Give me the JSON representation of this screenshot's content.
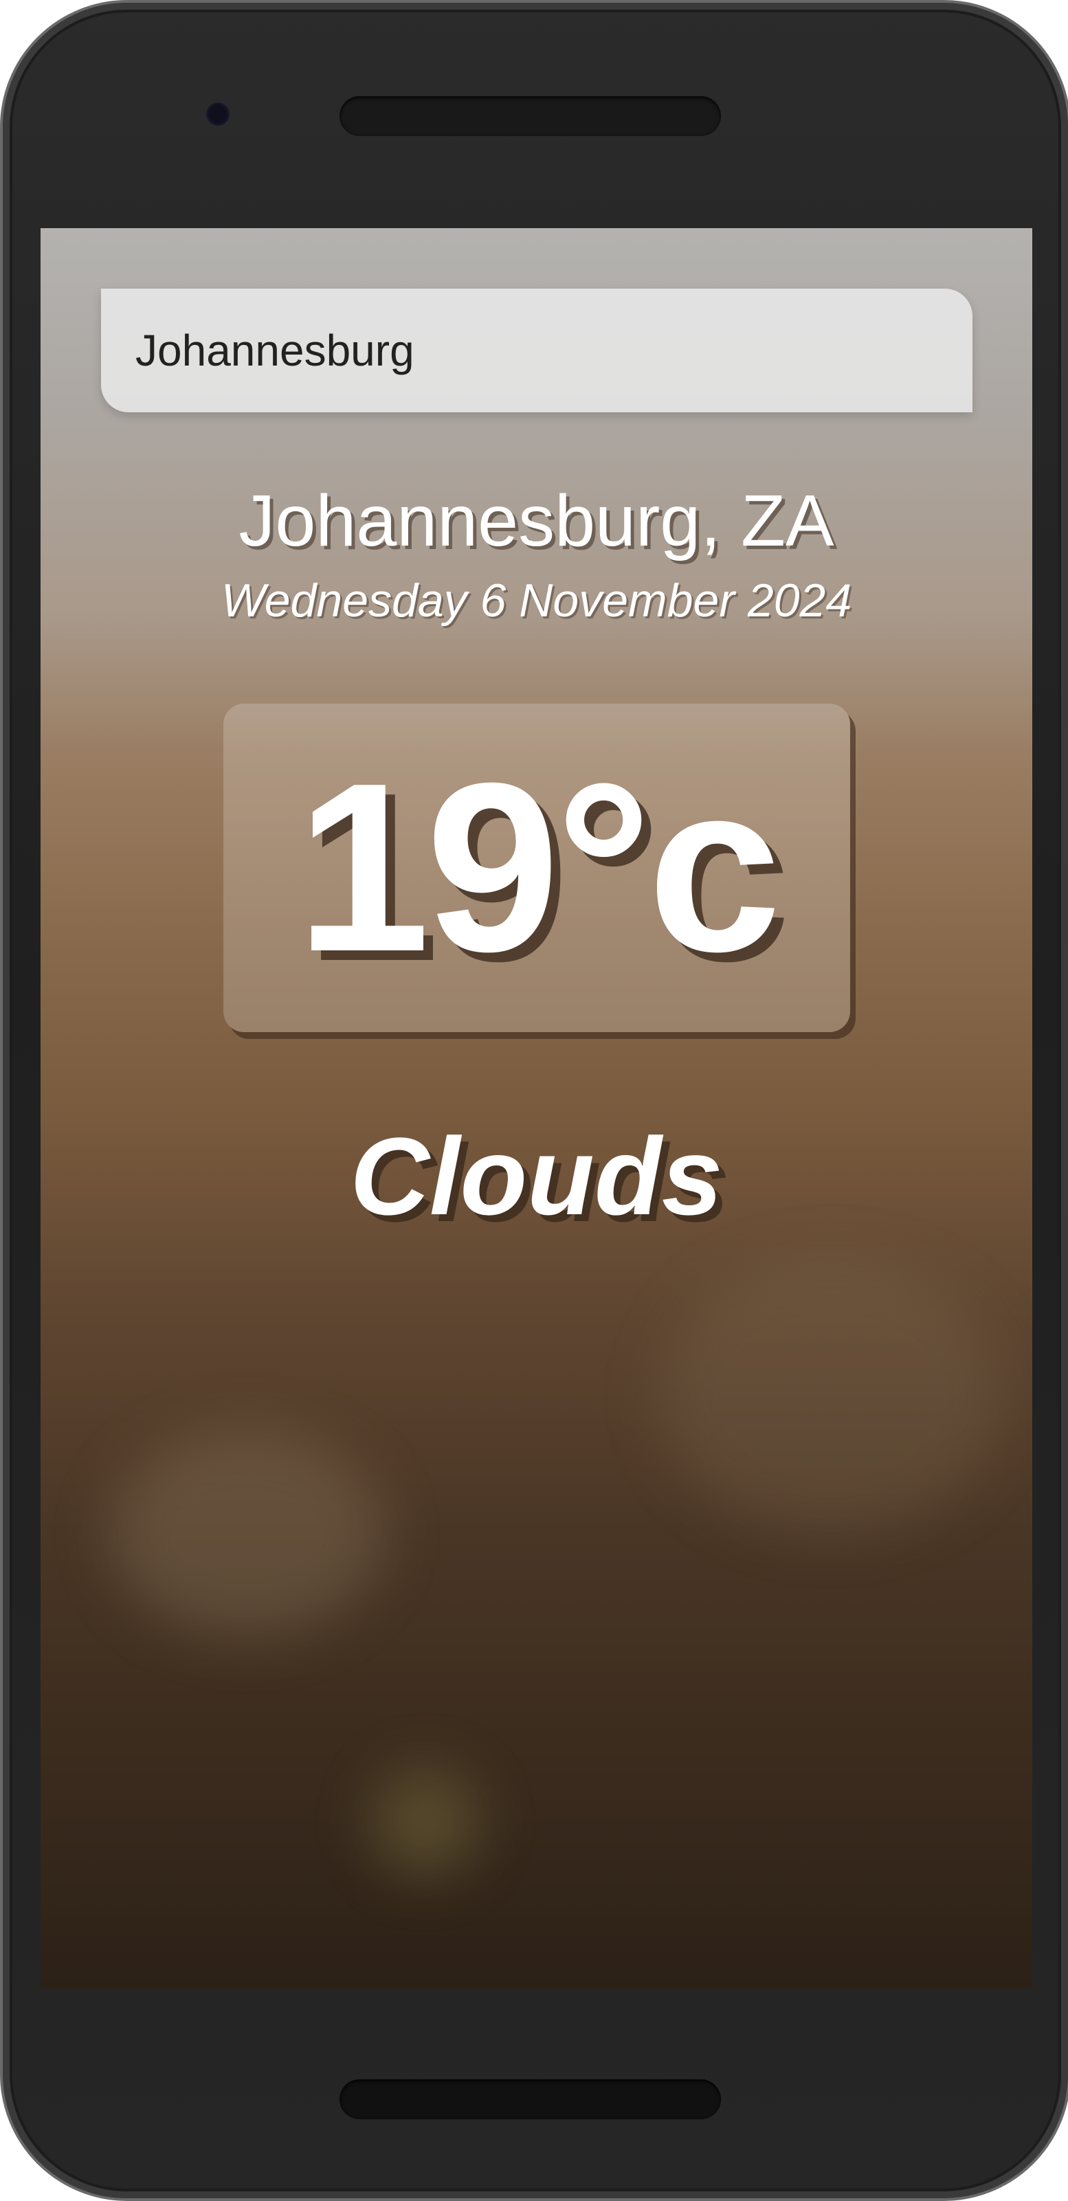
{
  "search": {
    "value": "Johannesburg"
  },
  "weather": {
    "location": "Johannesburg, ZA",
    "date": "Wednesday 6 November 2024",
    "temperature": "19°c",
    "condition": "Clouds"
  }
}
